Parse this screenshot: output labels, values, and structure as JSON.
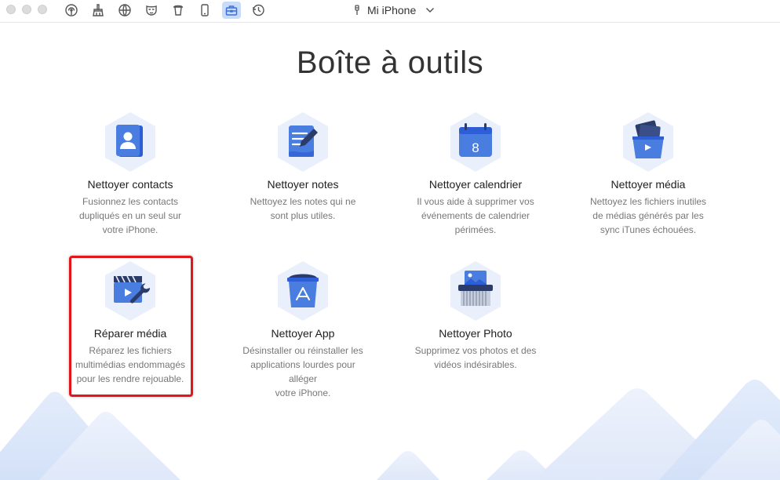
{
  "app": {
    "device_name": "Mi iPhone",
    "accent_color": "#4a7de0",
    "highlight_color": "#e0161b"
  },
  "toolbar": {
    "icons": [
      {
        "name": "airbackup-icon"
      },
      {
        "name": "cleaner-brush-icon"
      },
      {
        "name": "globe-icon"
      },
      {
        "name": "privacy-mask-icon"
      },
      {
        "name": "trash-icon"
      },
      {
        "name": "device-icon"
      },
      {
        "name": "toolbox-icon",
        "active": true
      },
      {
        "name": "history-icon"
      }
    ]
  },
  "page": {
    "title": "Boîte à outils"
  },
  "tools": [
    {
      "id": "contacts",
      "icon": "contacts-icon",
      "title": "Nettoyer contacts",
      "desc": [
        "Fusionnez les contacts",
        "dupliqués en un seul sur",
        "votre iPhone."
      ]
    },
    {
      "id": "notes",
      "icon": "notes-icon",
      "title": "Nettoyer notes",
      "desc": [
        "Nettoyez les notes qui ne",
        "sont plus utiles."
      ]
    },
    {
      "id": "calendar",
      "icon": "calendar-icon",
      "title": "Nettoyer calendrier",
      "desc": [
        "Il vous aide à supprimer vos",
        "événements de calendrier",
        "périmées."
      ],
      "calendar_day": "8"
    },
    {
      "id": "media",
      "icon": "media-icon",
      "title": "Nettoyer média",
      "desc": [
        "Nettoyez les fichiers inutiles",
        "de médias générés par les",
        "sync iTunes échouées."
      ]
    },
    {
      "id": "repair",
      "icon": "repair-media-icon",
      "title": "Réparer média",
      "desc": [
        "Réparez les fichiers",
        "multimédias endommagés",
        "pour les rendre rejouable."
      ],
      "highlighted": true
    },
    {
      "id": "app",
      "icon": "app-store-icon",
      "title": "Nettoyer App",
      "desc": [
        "Désinstaller ou réinstaller les",
        "applications lourdes pour alléger",
        "votre iPhone."
      ]
    },
    {
      "id": "photo",
      "icon": "photo-shredder-icon",
      "title": "Nettoyer Photo",
      "desc": [
        "Supprimez vos photos et des",
        "vidéos indésirables."
      ]
    }
  ]
}
